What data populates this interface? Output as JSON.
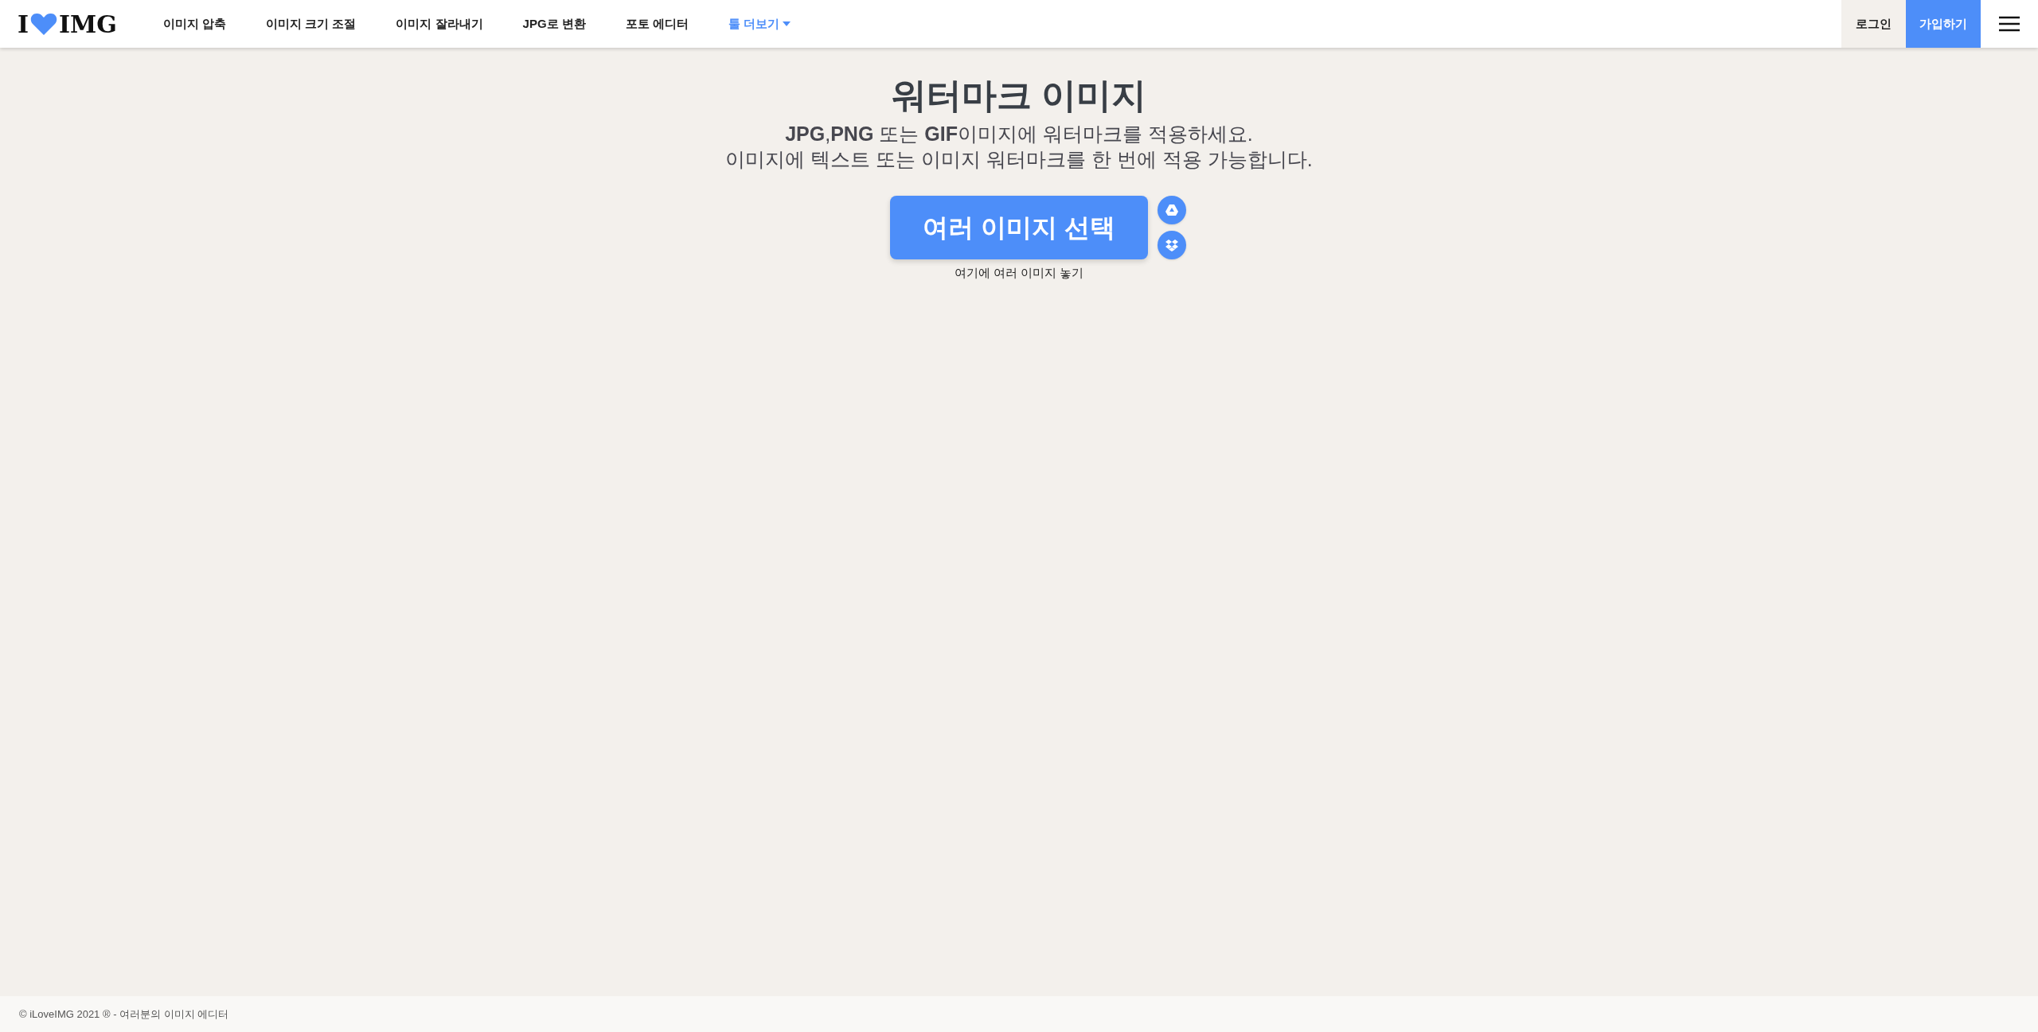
{
  "logo": {
    "left": "I",
    "right": "IMG"
  },
  "nav": [
    {
      "label": "이미지 압축",
      "highlighted": false,
      "dropdown": false
    },
    {
      "label": "이미지 크기 조절",
      "highlighted": false,
      "dropdown": false
    },
    {
      "label": "이미지 잘라내기",
      "highlighted": false,
      "dropdown": false
    },
    {
      "label": "JPG로 변환",
      "highlighted": false,
      "dropdown": false
    },
    {
      "label": "포토 에디터",
      "highlighted": false,
      "dropdown": false
    },
    {
      "label": "툴 더보기",
      "highlighted": true,
      "dropdown": true
    }
  ],
  "login": "로그인",
  "signup": "가입하기",
  "title": "워터마크 이미지",
  "subtitle": [
    "**JPG**,**PNG** 또는 **GIF**이미지에 워터마크를 적용하세요.",
    "이미지에 텍스트 또는 이미지 워터마크를 한 번에 적용 가능합니다."
  ],
  "select_button": "여러 이미지 선택",
  "drop_hint": "여기에 여러 이미지 놓기",
  "footer": "© iLoveIMG 2021 ® - 여러분의 이미지 에디터"
}
